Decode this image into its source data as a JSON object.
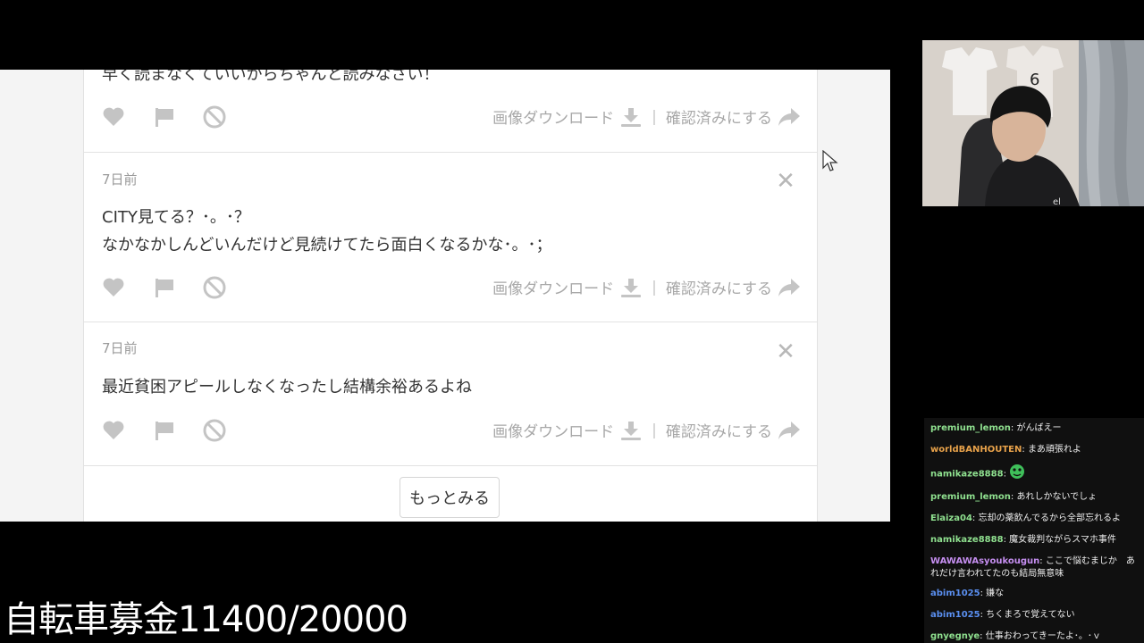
{
  "cards": [
    {
      "message": "早く読まなくていいからちゃんと読みなさい！",
      "actions": {
        "download": "画像ダウンロード",
        "mark_done": "確認済みにする"
      }
    },
    {
      "time": "7日前",
      "message_lines": [
        "CITY見てる？･。･？",
        "なかなかしんどいんだけど見続けてたら面白くなるかな･。･；"
      ],
      "actions": {
        "download": "画像ダウンロード",
        "mark_done": "確認済みにする"
      }
    },
    {
      "time": "7日前",
      "message_lines": [
        "最近貧困アピールしなくなったし結構余裕あるよね"
      ],
      "actions": {
        "download": "画像ダウンロード",
        "mark_done": "確認済みにする"
      }
    }
  ],
  "more_button": "もっとみる",
  "chat": [
    {
      "user": "premium_lemon",
      "color": "#8fe08f",
      "text": "がんばえー"
    },
    {
      "user": "worldBANHOUTEN",
      "color": "#e8a24a",
      "text": "まあ頑張れよ"
    },
    {
      "user": "namikaze8888",
      "color": "#8fe08f",
      "text": "",
      "emote": "green-face-emote"
    },
    {
      "user": "premium_lemon",
      "color": "#8fe08f",
      "text": "あれしかないでしょ"
    },
    {
      "user": "Elaiza04",
      "color": "#8fe08f",
      "text": "忘却の薬飲んでるから全部忘れるよ"
    },
    {
      "user": "namikaze8888",
      "color": "#8fe08f",
      "text": "魔女裁判ながらスマホ事件"
    },
    {
      "user": "WAWAWAsyoukougun",
      "color": "#c58ef0",
      "text": "ここで悩むまじか　あれだけ言われてたのも結局無意味"
    },
    {
      "user": "abim1025",
      "color": "#5a8ff0",
      "text": "嫌な"
    },
    {
      "user": "abim1025",
      "color": "#5a8ff0",
      "text": "ちくまろで覚えてない"
    },
    {
      "user": "gnyegnye",
      "color": "#8fe08f",
      "text": "仕事おわってきーたよ･。･ｖ"
    }
  ],
  "donation": "自転車募金11400/20000",
  "colors": {
    "icon_gray": "#c4c4c4",
    "text_dark": "#333333",
    "text_gray": "#a8a8a8"
  }
}
